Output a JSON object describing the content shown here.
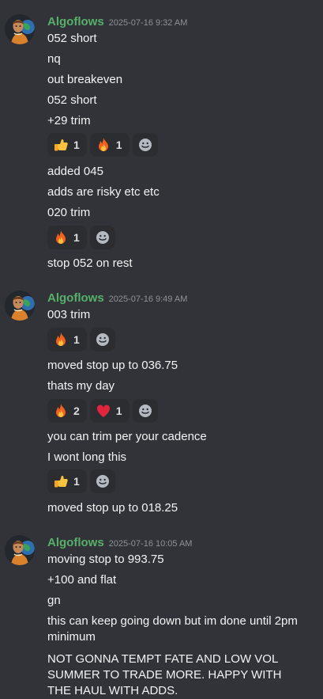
{
  "groups": [
    {
      "author": "Algoflows",
      "timestamp": "2025-07-16 9:32 AM",
      "lines": [
        "052 short",
        "nq",
        "out breakeven",
        "052 short",
        "+29 trim",
        "added 045",
        "adds are risky etc etc",
        "020 trim",
        "stop 052 on rest"
      ],
      "reactions": [
        [
          {
            "emoji": "thumbs-up-icon",
            "count": "1"
          },
          {
            "emoji": "fire-icon",
            "count": "1"
          }
        ],
        [
          {
            "emoji": "fire-icon",
            "count": "1"
          }
        ]
      ]
    },
    {
      "author": "Algoflows",
      "timestamp": "2025-07-16 9:49 AM",
      "lines": [
        "003 trim",
        "moved stop up to 036.75",
        "thats my day",
        "you can trim per your cadence",
        "I wont long this",
        "moved stop up to 018.25"
      ],
      "reactions": [
        [
          {
            "emoji": "fire-icon",
            "count": "1"
          }
        ],
        [
          {
            "emoji": "fire-icon",
            "count": "2"
          },
          {
            "emoji": "heart-icon",
            "count": "1"
          }
        ],
        [
          {
            "emoji": "thumbs-up-icon",
            "count": "1"
          }
        ]
      ]
    },
    {
      "author": "Algoflows",
      "timestamp": "2025-07-16 10:05 AM",
      "lines": [
        "moving stop to 993.75",
        "+100 and flat",
        "gn",
        "this can keep going down but im done until 2pm minimum",
        "NOT GONNA TEMPT FATE AND LOW VOL SUMMER TO TRADE MORE. HAPPY WITH THE HAUL WITH ADDS."
      ]
    }
  ],
  "colors": {
    "background": "#313338",
    "author": "#57b06a",
    "timestamp": "#8e9297",
    "reaction_bg": "#2b2d31"
  }
}
